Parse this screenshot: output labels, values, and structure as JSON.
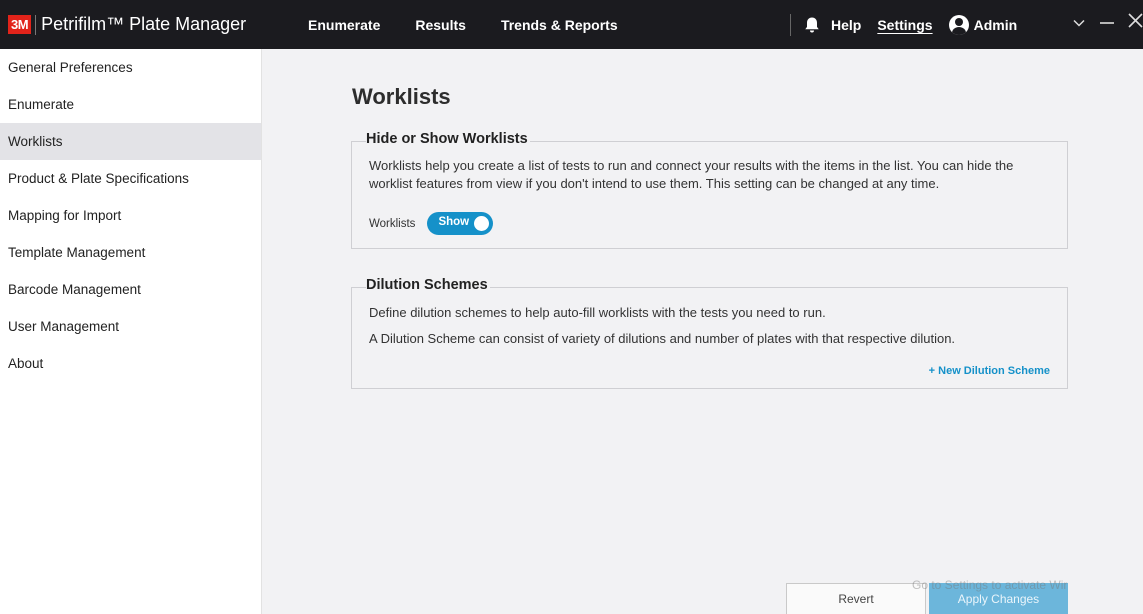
{
  "header": {
    "logo": "3M",
    "app_title": "Petrifilm™ Plate Manager",
    "nav": [
      "Enumerate",
      "Results",
      "Trends & Reports"
    ],
    "help": "Help",
    "settings": "Settings",
    "user": "Admin",
    "icons": {
      "notifications": "bell-icon",
      "user": "user-icon",
      "menu": "chevron-down-icon",
      "minimize": "minimize-icon",
      "close": "close-icon"
    }
  },
  "sidebar": {
    "items": [
      "General Preferences",
      "Enumerate",
      "Worklists",
      "Product & Plate Specifications",
      "Mapping for Import",
      "Template Management",
      "Barcode Management",
      "User Management",
      "About"
    ],
    "active": "Worklists"
  },
  "main": {
    "title": "Worklists",
    "hide_show": {
      "legend": "Hide or Show Worklists",
      "description": "Worklists help you create a list of tests to run and connect your results with the items in the list. You can hide the worklist features from view if you don't intend to use them. This setting can be changed at any time.",
      "toggle_label": "Worklists",
      "toggle_value": "Show"
    },
    "dilution": {
      "legend": "Dilution Schemes",
      "line1": "Define dilution schemes to help auto-fill worklists with the tests you need to run.",
      "line2": "A Dilution Scheme can consist of variety of dilutions and number of plates with that respective dilution.",
      "new_link": "+ New Dilution Scheme"
    }
  },
  "footer": {
    "revert": "Revert",
    "apply": "Apply Changes",
    "watermark": "Go to Settings to activate Wir"
  },
  "colors": {
    "accent": "#1591c9",
    "topbar": "#1b1b1f",
    "brand_red": "#e2231a"
  }
}
